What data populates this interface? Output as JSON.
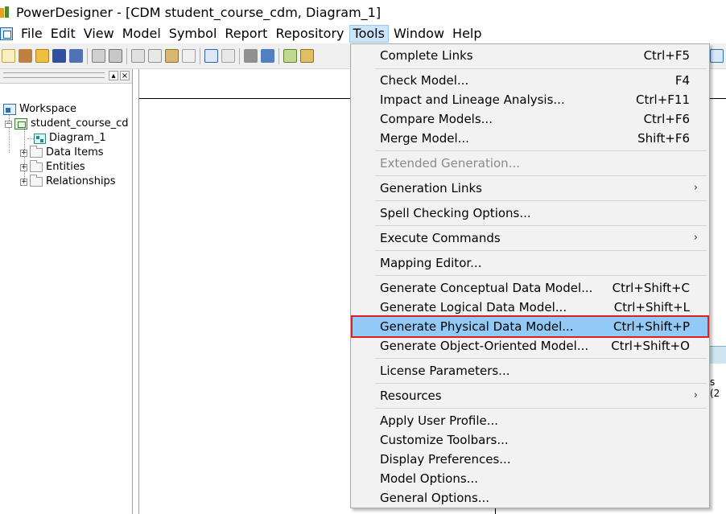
{
  "window": {
    "title": "PowerDesigner - [CDM student_course_cdm, Diagram_1]"
  },
  "menubar": {
    "items": [
      {
        "label": "File"
      },
      {
        "label": "Edit"
      },
      {
        "label": "View"
      },
      {
        "label": "Model"
      },
      {
        "label": "Symbol"
      },
      {
        "label": "Report"
      },
      {
        "label": "Repository"
      },
      {
        "label": "Tools"
      },
      {
        "label": "Window"
      },
      {
        "label": "Help"
      }
    ],
    "active": "Tools"
  },
  "browser": {
    "tree": [
      {
        "label": "Workspace"
      },
      {
        "label": "student_course_cd"
      },
      {
        "label": "Diagram_1"
      },
      {
        "label": "Data Items"
      },
      {
        "label": "Entities"
      },
      {
        "label": "Relationships"
      }
    ],
    "close_label": "×"
  },
  "tools_menu": {
    "items": [
      {
        "label": "Complete Links",
        "shortcut": "Ctrl+F5"
      },
      {
        "label": "Check Model...",
        "shortcut": "F4"
      },
      {
        "label": "Impact and Lineage Analysis...",
        "shortcut": "Ctrl+F11"
      },
      {
        "label": "Compare Models...",
        "shortcut": "Ctrl+F6"
      },
      {
        "label": "Merge Model...",
        "shortcut": "Shift+F6"
      },
      {
        "label": "Extended Generation...",
        "shortcut": "",
        "disabled": true
      },
      {
        "label": "Generation Links",
        "shortcut": "",
        "submenu": true
      },
      {
        "label": "Spell Checking Options...",
        "shortcut": ""
      },
      {
        "label": "Execute Commands",
        "shortcut": "",
        "submenu": true
      },
      {
        "label": "Mapping Editor...",
        "shortcut": ""
      },
      {
        "label": "Generate Conceptual Data Model...",
        "shortcut": "Ctrl+Shift+C"
      },
      {
        "label": "Generate Logical Data Model...",
        "shortcut": "Ctrl+Shift+L"
      },
      {
        "label": "Generate Physical Data Model...",
        "shortcut": "Ctrl+Shift+P",
        "highlighted": true
      },
      {
        "label": "Generate Object-Oriented Model...",
        "shortcut": "Ctrl+Shift+O"
      },
      {
        "label": "License Parameters...",
        "shortcut": ""
      },
      {
        "label": "Resources",
        "shortcut": "",
        "submenu": true
      },
      {
        "label": "Apply User Profile...",
        "shortcut": ""
      },
      {
        "label": "Customize Toolbars...",
        "shortcut": ""
      },
      {
        "label": "Display Preferences...",
        "shortcut": ""
      },
      {
        "label": "Model Options...",
        "shortcut": ""
      },
      {
        "label": "General Options...",
        "shortcut": ""
      }
    ],
    "submenu_arrow": "›"
  },
  "diagram": {
    "partial_text": "s (2"
  },
  "colors": {
    "highlight": "#91c9f7",
    "highlight_border": "#e02020",
    "menu_bg": "#f2f2f2",
    "menubar_active": "#cce4f7"
  }
}
